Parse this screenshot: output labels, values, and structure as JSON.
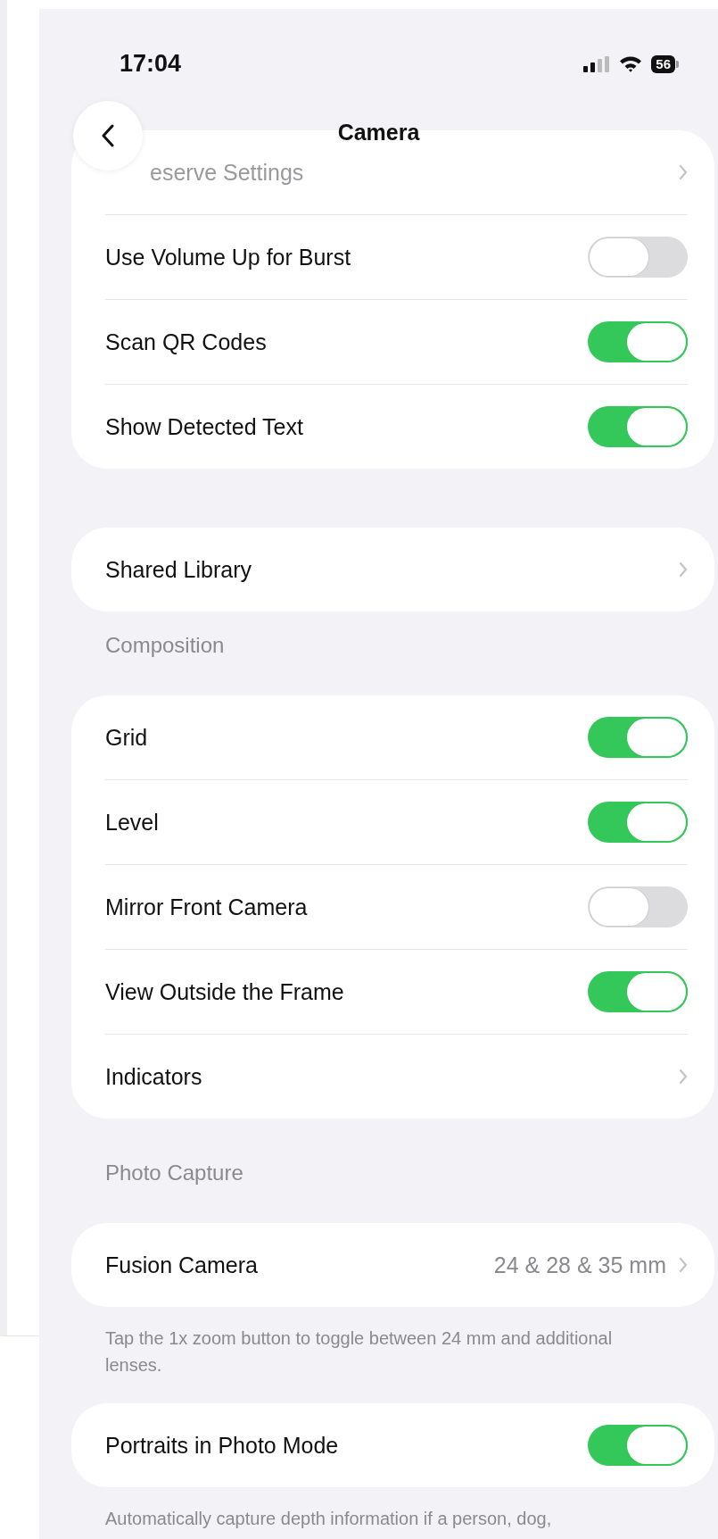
{
  "status_bar": {
    "time": "17:04",
    "battery": "56"
  },
  "nav": {
    "title": "Camera"
  },
  "groups": [
    {
      "rows": [
        {
          "kind": "link",
          "label": "eserve Settings"
        },
        {
          "kind": "toggle",
          "label": "Use Volume Up for Burst",
          "on": false
        },
        {
          "kind": "toggle",
          "label": "Scan QR Codes",
          "on": true
        },
        {
          "kind": "toggle",
          "label": "Show Detected Text",
          "on": true
        }
      ]
    },
    {
      "rows": [
        {
          "kind": "link",
          "label": "Shared Library"
        }
      ]
    },
    {
      "header": "Composition",
      "rows": [
        {
          "kind": "toggle",
          "label": "Grid",
          "on": true
        },
        {
          "kind": "toggle",
          "label": "Level",
          "on": true
        },
        {
          "kind": "toggle",
          "label": "Mirror Front Camera",
          "on": false
        },
        {
          "kind": "toggle",
          "label": "View Outside the Frame",
          "on": true
        },
        {
          "kind": "link",
          "label": "Indicators"
        }
      ]
    },
    {
      "header": "Photo Capture",
      "rows": [
        {
          "kind": "link",
          "label": "Fusion Camera",
          "value": "24 & 28 & 35 mm"
        }
      ],
      "footer": "Tap the 1x zoom button to toggle between 24 mm and additional lenses."
    },
    {
      "rows": [
        {
          "kind": "toggle",
          "label": "Portraits in Photo Mode",
          "on": true
        }
      ],
      "footer": "Automatically capture depth information if a person, dog,"
    }
  ]
}
